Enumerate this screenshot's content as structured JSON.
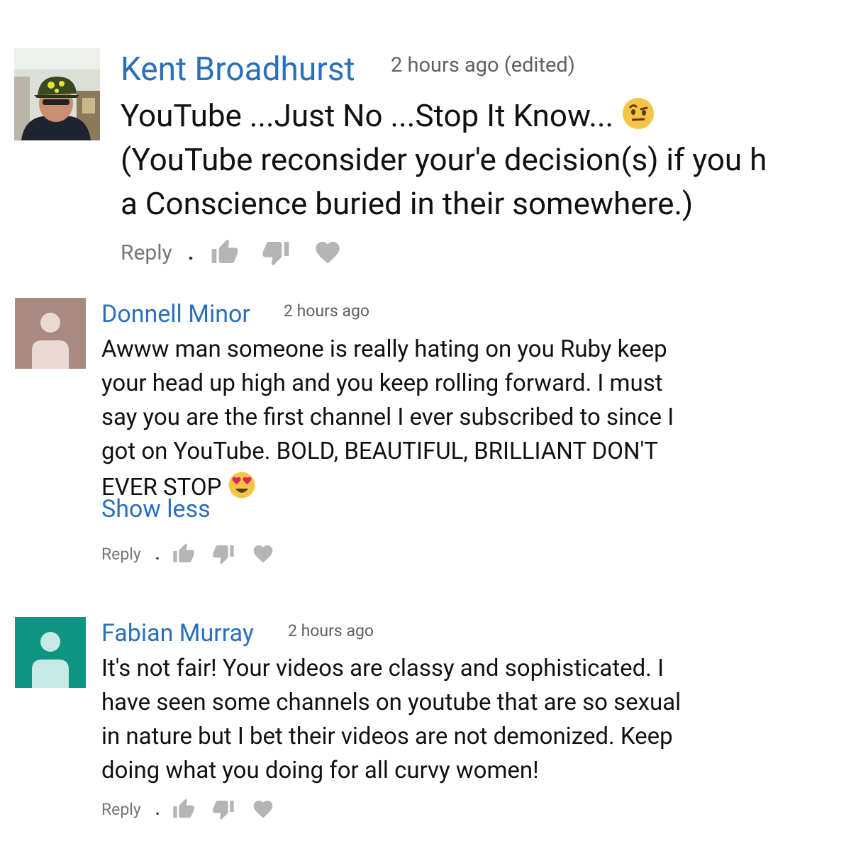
{
  "comments": [
    {
      "author": "Kent Broadhurst",
      "timestamp": "2 hours ago (edited)",
      "lines": [
        "YouTube ...Just No ...Stop It Know...",
        "(YouTube reconsider your'e decision(s) if you h",
        "a Conscience buried in their somewhere.)"
      ],
      "emoji": "raised-eyebrow-face",
      "reply_label": "Reply",
      "separator": "."
    },
    {
      "author": "Donnell Minor",
      "timestamp": "2 hours ago",
      "lines": [
        "Awww man someone is really hating on you Ruby keep",
        "your head up high and you keep rolling forward. I must",
        "say you are the first channel I ever subscribed to since I",
        "got on YouTube. BOLD, BEAUTIFUL, BRILLIANT DON'T",
        "EVER STOP"
      ],
      "emoji": "heart-eyes-face",
      "show_less": "Show less",
      "avatar_color": "#a98a80",
      "reply_label": "Reply",
      "separator": "."
    },
    {
      "author": "Fabian Murray",
      "timestamp": "2 hours ago",
      "lines": [
        "It's not fair! Your videos are classy and sophisticated. I",
        "have seen some channels on youtube that are so sexual",
        "in nature but I bet their videos are not demonized. Keep",
        "doing what you doing for all curvy women!"
      ],
      "avatar_color": "#0f9484",
      "reply_label": "Reply",
      "separator": "."
    }
  ]
}
